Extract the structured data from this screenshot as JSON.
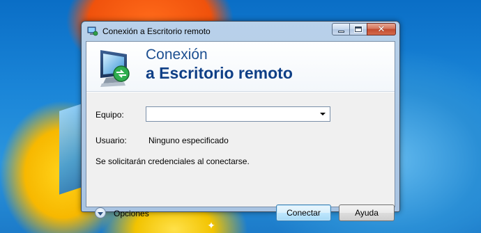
{
  "window": {
    "title": "Conexión a Escritorio remoto",
    "buttons": {
      "minimize": "minimize",
      "maximize": "maximize",
      "close": "close"
    }
  },
  "banner": {
    "line1": "Conexión",
    "line2": "a Escritorio remoto",
    "icon": "remote-desktop-monitor-icon"
  },
  "form": {
    "computer_label": "Equipo:",
    "computer_value": "",
    "user_label": "Usuario:",
    "user_value": "Ninguno especificado",
    "credentials_note": "Se solicitarán credenciales al conectarse."
  },
  "footer": {
    "options_label": "Opciones",
    "connect_label": "Conectar",
    "help_label": "Ayuda"
  },
  "colors": {
    "banner_text": "#0f3f86",
    "primary_button_border": "#3c7fb1",
    "close_button": "#c24a2e"
  }
}
